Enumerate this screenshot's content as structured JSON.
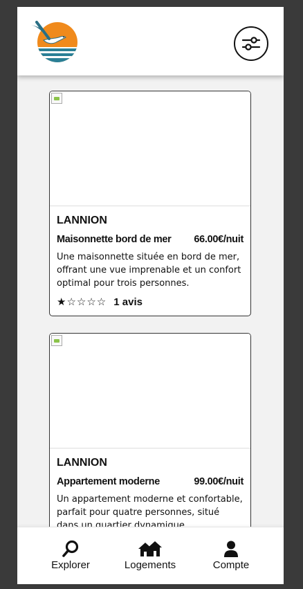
{
  "header": {
    "logo_icon": "seagull-sunset-logo",
    "filter_icon": "sliders-icon"
  },
  "listings": [
    {
      "city": "LANNION",
      "title": "Maisonnette bord de mer",
      "price": "66.00€/nuit",
      "description": "Une maisonnette située en bord de mer, offrant une vue imprenable et un confort optimal pour trois personnes.",
      "rating": 1,
      "stars": "★☆☆☆☆",
      "reviews": "1 avis"
    },
    {
      "city": "LANNION",
      "title": "Appartement moderne",
      "price": "99.00€/nuit",
      "description": "Un appartement moderne et confortable, parfait pour quatre personnes, situé dans un quartier dynamique."
    }
  ],
  "navbar": {
    "items": [
      {
        "label": "Explorer",
        "icon": "search-icon"
      },
      {
        "label": "Logements",
        "icon": "houses-icon"
      },
      {
        "label": "Compte",
        "icon": "user-icon"
      }
    ]
  },
  "colors": {
    "sun_orange": "#f08a1c",
    "sea_teal": "#2a7f95",
    "background": "#3a3a3a"
  }
}
